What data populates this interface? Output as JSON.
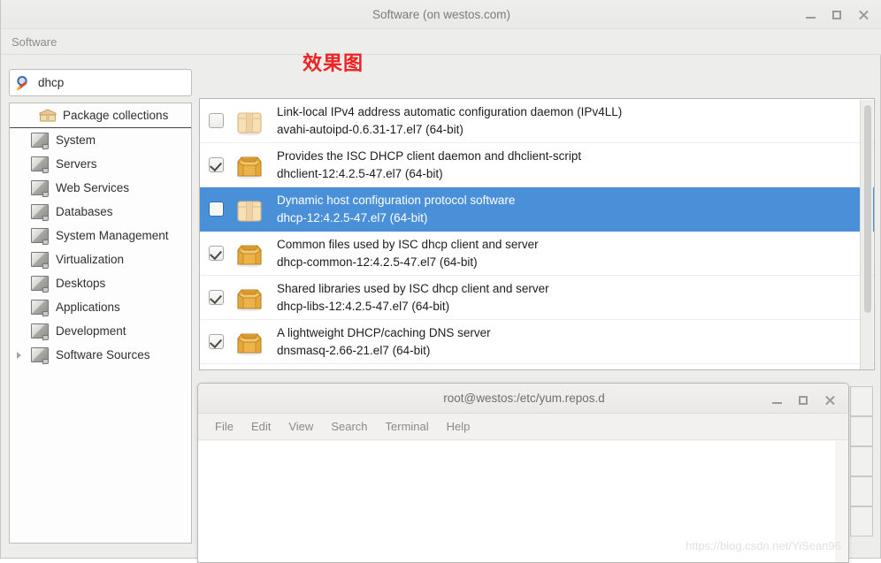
{
  "window": {
    "title": "Software (on westos.com)",
    "controls": {
      "minimize": "–",
      "maximize": "□",
      "close": "✕"
    }
  },
  "menubar": {
    "items": [
      "Software"
    ]
  },
  "annotation": {
    "text": "效果图",
    "color": "#f01f22"
  },
  "search": {
    "value": "dhcp",
    "placeholder": "Search",
    "icon": "search-icon"
  },
  "sidebar": {
    "items": [
      {
        "label": "Package collections",
        "icon": "package-collection-icon",
        "expander": false,
        "header": true
      },
      {
        "label": "System",
        "icon": "monitor-icon",
        "expander": false,
        "header": false
      },
      {
        "label": "Servers",
        "icon": "monitor-icon",
        "expander": false,
        "header": false
      },
      {
        "label": "Web Services",
        "icon": "monitor-icon",
        "expander": false,
        "header": false
      },
      {
        "label": "Databases",
        "icon": "monitor-icon",
        "expander": false,
        "header": false
      },
      {
        "label": "System Management",
        "icon": "monitor-icon",
        "expander": false,
        "header": false
      },
      {
        "label": "Virtualization",
        "icon": "monitor-icon",
        "expander": false,
        "header": false
      },
      {
        "label": "Desktops",
        "icon": "monitor-icon",
        "expander": false,
        "header": false
      },
      {
        "label": "Applications",
        "icon": "monitor-icon",
        "expander": false,
        "header": false
      },
      {
        "label": "Development",
        "icon": "monitor-icon",
        "expander": false,
        "header": false
      },
      {
        "label": "Software Sources",
        "icon": "monitor-icon",
        "expander": true,
        "header": false
      }
    ]
  },
  "package_list": {
    "selection_color": "#4a90d9",
    "rows": [
      {
        "summary": "Link-local IPv4 address automatic configuration daemon (IPv4LL)",
        "name": "avahi-autoipd-0.6.31-17.el7 (64-bit)",
        "checked": false,
        "installed": false,
        "selected": false
      },
      {
        "summary": "Provides the ISC DHCP client daemon and dhclient-script",
        "name": "dhclient-12:4.2.5-47.el7 (64-bit)",
        "checked": true,
        "installed": true,
        "selected": false
      },
      {
        "summary": "Dynamic host configuration protocol software",
        "name": "dhcp-12:4.2.5-47.el7 (64-bit)",
        "checked": false,
        "installed": false,
        "selected": true
      },
      {
        "summary": "Common files used by ISC dhcp client and server",
        "name": "dhcp-common-12:4.2.5-47.el7 (64-bit)",
        "checked": true,
        "installed": true,
        "selected": false
      },
      {
        "summary": "Shared libraries used by ISC dhcp client and server",
        "name": "dhcp-libs-12:4.2.5-47.el7 (64-bit)",
        "checked": true,
        "installed": true,
        "selected": false
      },
      {
        "summary": "A lightweight DHCP/caching DNS server",
        "name": "dnsmasq-2.66-21.el7 (64-bit)",
        "checked": true,
        "installed": true,
        "selected": false
      }
    ]
  },
  "terminal": {
    "title": "root@westos:/etc/yum.repos.d",
    "menu": [
      "File",
      "Edit",
      "View",
      "Search",
      "Terminal",
      "Help"
    ],
    "body_text": "",
    "controls": {
      "minimize": "–",
      "maximize": "□",
      "close": "✕"
    }
  },
  "watermark": {
    "text": "https://blog.csdn.net/YiSean96"
  }
}
